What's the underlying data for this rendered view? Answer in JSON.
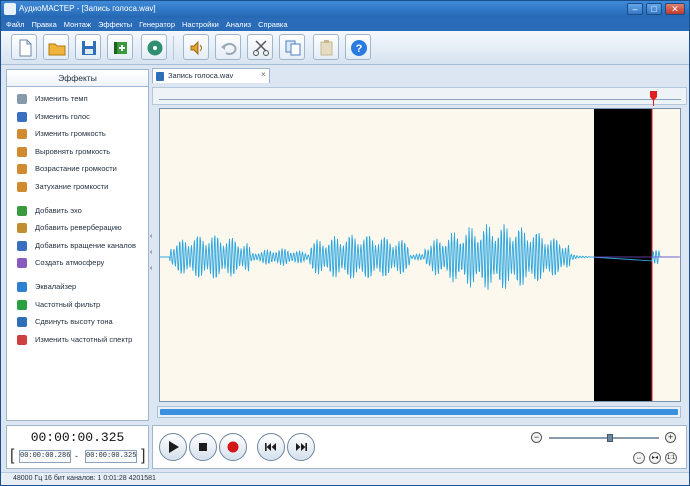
{
  "window": {
    "title": "АудиоМАСТЕР - [Запись голоса.wav]",
    "controls": [
      "–",
      "□",
      "✕"
    ]
  },
  "menu": [
    "Файл",
    "Правка",
    "Монтаж",
    "Эффекты",
    "Генератор",
    "Настройки",
    "Анализ",
    "Справка"
  ],
  "toolbar": [
    {
      "name": "new-file-icon",
      "color": "#dfe9f5"
    },
    {
      "name": "open-folder-icon",
      "color": "#f0b43c"
    },
    {
      "name": "save-icon",
      "color": "#2f6fb8"
    },
    {
      "name": "add-clip-icon",
      "color": "#3b9a3b"
    },
    {
      "name": "import-disc-icon",
      "color": "#2f8f70"
    },
    {
      "name": "speaker-icon",
      "color": "#e0a030"
    },
    {
      "name": "undo-icon",
      "color": "#9aa8b8"
    },
    {
      "name": "cut-icon",
      "color": "#555555"
    },
    {
      "name": "copy-icon",
      "color": "#4a7fc0"
    },
    {
      "name": "paste-icon",
      "color": "#c8b890"
    },
    {
      "name": "help-icon",
      "color": "#2a7be0"
    }
  ],
  "effects_panel": {
    "header": "Эффекты",
    "items": [
      {
        "label": "Изменить темп",
        "icon": "clock-icon",
        "color": "#8899aa"
      },
      {
        "label": "Изменить голос",
        "icon": "person-icon",
        "color": "#3a6fc0"
      },
      {
        "label": "Изменить громкость",
        "icon": "speaker-icon",
        "color": "#d08a30"
      },
      {
        "label": "Выровнять громкость",
        "icon": "speaker-level-icon",
        "color": "#d08a30"
      },
      {
        "label": "Возрастание громкости",
        "icon": "speaker-up-icon",
        "color": "#d08a30"
      },
      {
        "label": "Затухание громкости",
        "icon": "speaker-down-icon",
        "color": "#d08a30"
      },
      {
        "label": "Добавить эхо",
        "icon": "echo-icon",
        "color": "#3a9a40"
      },
      {
        "label": "Добавить реверберацию",
        "icon": "reverb-icon",
        "color": "#c09030"
      },
      {
        "label": "Добавить вращение каналов",
        "icon": "channels-icon",
        "color": "#3a6fc0"
      },
      {
        "label": "Создать атмосферу",
        "icon": "atmosphere-icon",
        "color": "#8a5bbf"
      },
      {
        "label": "Эквалайзер",
        "icon": "equalizer-icon",
        "color": "#2f7fd0"
      },
      {
        "label": "Частотный фильтр",
        "icon": "filter-icon",
        "color": "#2aa040"
      },
      {
        "label": "Сдвинуть высоту тона",
        "icon": "pitch-icon",
        "color": "#2f6fb8"
      },
      {
        "label": "Изменить частотный спектр",
        "icon": "spectrum-icon",
        "color": "#d04040"
      }
    ]
  },
  "tab": {
    "label": "Запись голоса.wav",
    "close": "×"
  },
  "waveform": {
    "color": "#2ea7e0",
    "selection_color": "#000000",
    "marker_color": "#e02020"
  },
  "time": {
    "current": "00:00:00.325",
    "start": "00:00:00.286",
    "end": "00:00:00.325",
    "dash": "-",
    "bracket_left": "[",
    "bracket_right": "]"
  },
  "transport": {
    "buttons": [
      {
        "name": "play-icon"
      },
      {
        "name": "stop-icon"
      },
      {
        "name": "record-icon"
      },
      {
        "name": "rewind-icon"
      },
      {
        "name": "forward-icon"
      }
    ],
    "zoom": {
      "minus": "−",
      "plus": "+",
      "level": 0.57,
      "fit": "1:1"
    }
  },
  "status": {
    "text": "48000 Гц  16 бит  каналов: 1    0:01:28  4201581"
  }
}
